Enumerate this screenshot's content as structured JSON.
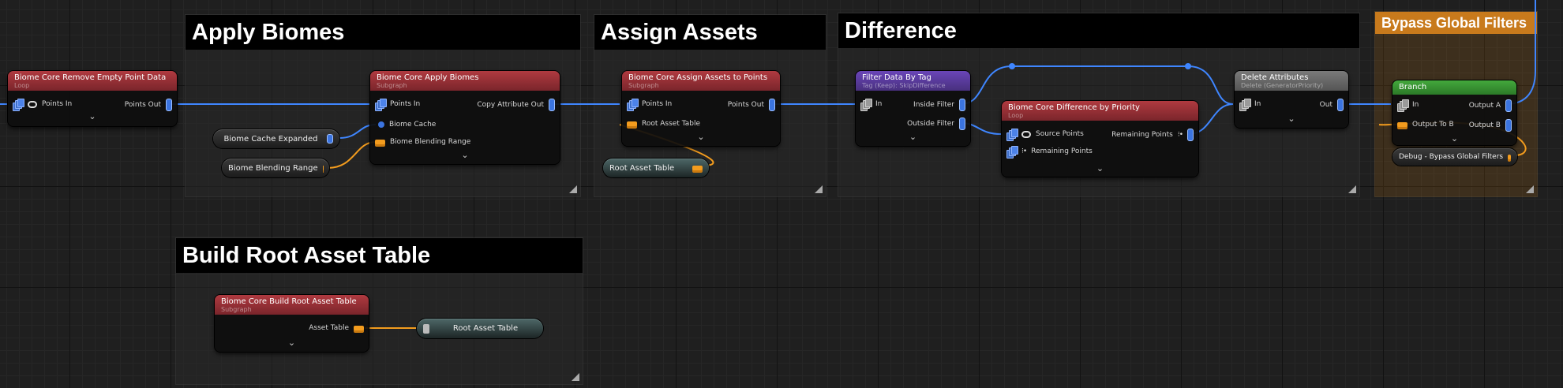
{
  "comments": {
    "apply_biomes": "Apply Biomes",
    "assign_assets": "Assign Assets",
    "difference": "Difference",
    "bypass_global_filters": "Bypass Global Filters",
    "build_root_asset_table": "Build Root Asset Table"
  },
  "nodes": {
    "remove_empty": {
      "title": "Biome Core Remove Empty Point Data",
      "subtitle": "Loop",
      "in_pin": "Points In",
      "out_pin": "Points Out"
    },
    "apply_biomes": {
      "title": "Biome Core Apply Biomes",
      "subtitle": "Subgraph",
      "in_pin": "Points In",
      "out_pin": "Copy Attribute Out",
      "pin_cache": "Biome Cache",
      "pin_range": "Biome Blending Range"
    },
    "assign_assets": {
      "title": "Biome Core Assign Assets to Points",
      "subtitle": "Subgraph",
      "in_pin": "Points In",
      "out_pin": "Points Out",
      "pin_table": "Root Asset Table"
    },
    "filter_tag": {
      "title": "Filter Data By Tag",
      "subtitle": "Tag (Keep): SkipDifference",
      "in_pin": "In",
      "out_inside": "Inside Filter",
      "out_outside": "Outside Filter"
    },
    "difference": {
      "title": "Biome Core Difference by Priority",
      "subtitle": "Loop",
      "in_source": "Source Points",
      "in_remaining": "Remaining Points",
      "out_remaining": "Remaining Points"
    },
    "delete_attr": {
      "title": "Delete Attributes",
      "subtitle": "Delete (GeneratorPriority)",
      "in_pin": "In",
      "out_pin": "Out"
    },
    "branch": {
      "title": "Branch",
      "in_pin": "In",
      "in_output_to": "Output To B",
      "out_a": "Output A",
      "out_b": "Output B"
    },
    "build_root": {
      "title": "Biome Core Build Root Asset Table",
      "subtitle": "Subgraph",
      "out_pin": "Asset Table"
    }
  },
  "variables": {
    "biome_cache_expanded": "Biome Cache Expanded",
    "biome_blending_range": "Biome Blending Range",
    "root_asset_table_get": "Root Asset Table",
    "root_asset_table_set": "Root Asset Table",
    "debug_bypass": "Debug - Bypass Global Filters"
  },
  "expand_glyph": "⌄",
  "colors": {
    "points_wire": "#3f86ff",
    "param_wire": "#f39c1e",
    "table_wire": "#f39c1e",
    "subgraph_header": "#9e343a",
    "filter_header": "#6a45b8",
    "delete_header": "#6e6e6e",
    "branch_header": "#3e9c36",
    "bypass_comment": "#c87a1c"
  }
}
